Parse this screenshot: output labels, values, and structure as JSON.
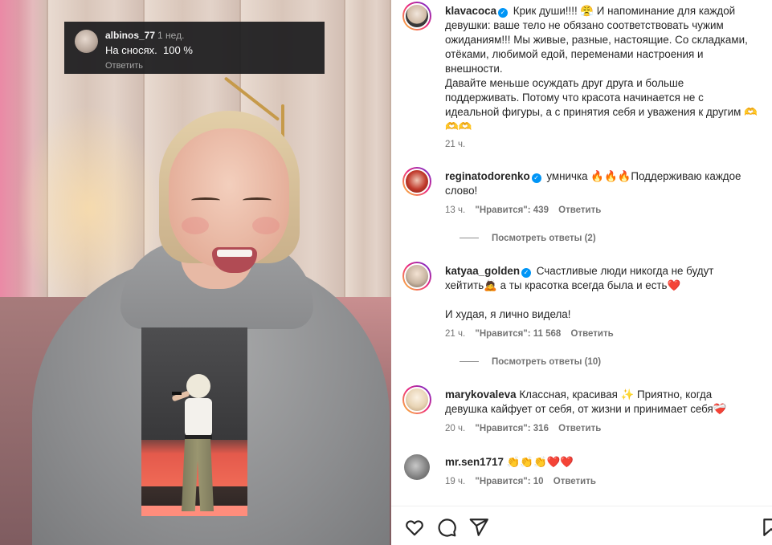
{
  "overlay_comment": {
    "username": "albinos_77",
    "time": "1 нед.",
    "text": "На сносях.  100 %",
    "reply": "Ответить"
  },
  "post": {
    "username": "klavacoca",
    "verified": true,
    "caption_lines": [
      "Крик души!!!! 😤 И напоминание для каждой",
      "девушки: ваше тело не обязано соответствовать чужим",
      "ожиданиям!!! Мы живые, разные, настоящие. Со складками,",
      "отёками, любимой едой, переменами настроения и",
      "внешности.",
      "Давайте меньше осуждать друг друга и больше",
      "поддерживать. Потому что красота начинается не с",
      "идеальной фигуры, а с принятия себя и уважения к другим 🫶",
      "🫶🫶"
    ],
    "time": "21 ч."
  },
  "comments": [
    {
      "username": "reginatodorenko",
      "verified": true,
      "lines": [
        "умничка 🔥🔥🔥Поддерживаю каждое",
        "слово!"
      ],
      "time": "13 ч.",
      "likes": "\"Нравится\": 439",
      "reply": "Ответить",
      "view_replies": "Посмотреть ответы (2)"
    },
    {
      "username": "katyaa_golden",
      "verified": true,
      "lines": [
        "Счастливые люди никогда не будут",
        "хейтить🙇 а ты красотка всегда была и есть❤️",
        "",
        "И худая, я лично видела!"
      ],
      "time": "21 ч.",
      "likes": "\"Нравится\": 11 568",
      "reply": "Ответить",
      "view_replies": "Посмотреть ответы (10)"
    },
    {
      "username": "marykovaleva",
      "verified": false,
      "lines": [
        "Классная, красивая ✨ Приятно, когда",
        "девушка кайфует от себя, от жизни и принимает себя❤️‍🩹"
      ],
      "time": "20 ч.",
      "likes": "\"Нравится\": 316",
      "reply": "Ответить"
    },
    {
      "username": "mr.sen1717",
      "verified": false,
      "lines": [
        "👏👏👏❤️❤️"
      ],
      "time": "19 ч.",
      "likes": "\"Нравится\": 10",
      "reply": "Ответить"
    }
  ],
  "actions": {
    "like": "heart-icon",
    "comment": "comment-bubble-icon",
    "share": "send-icon",
    "save": "bookmark-icon"
  },
  "colors": {
    "verified": "#0095f6",
    "text": "#262626",
    "muted": "#737373",
    "overlay_bg": "#1c1c1e"
  }
}
